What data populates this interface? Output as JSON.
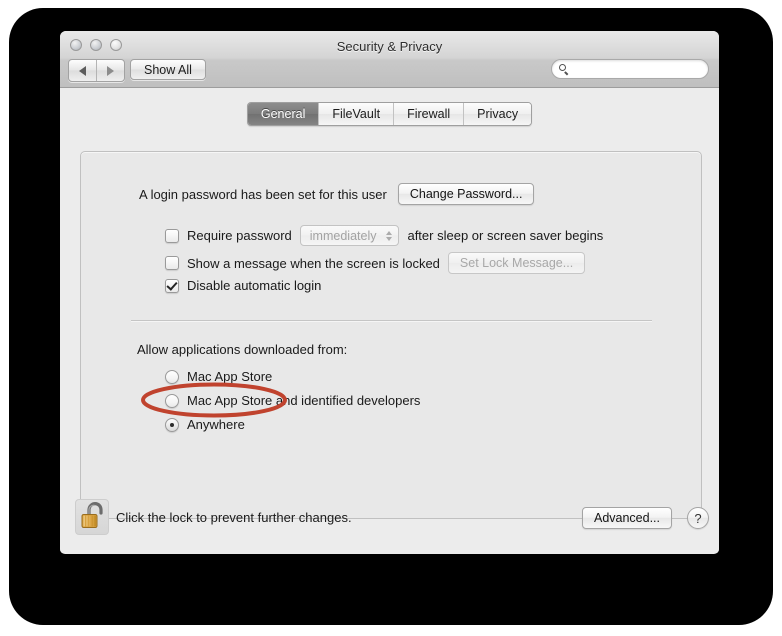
{
  "window": {
    "title": "Security & Privacy",
    "traffic_lights": [
      "close-button",
      "minimize-button",
      "zoom-button"
    ],
    "toolbar": {
      "back_label": "◀",
      "forward_label": "▶",
      "show_all_label": "Show All",
      "search_value": "",
      "search_placeholder": ""
    }
  },
  "tabs": [
    {
      "label": "General",
      "selected": true
    },
    {
      "label": "FileVault",
      "selected": false
    },
    {
      "label": "Firewall",
      "selected": false
    },
    {
      "label": "Privacy",
      "selected": false
    }
  ],
  "general": {
    "password_status": "A login password has been set for this user",
    "change_password_label": "Change Password...",
    "require_password": {
      "checked": false,
      "label_before": "Require password",
      "popup_value": "immediately",
      "popup_disabled": true,
      "label_after": "after sleep or screen saver begins"
    },
    "lock_message": {
      "checked": false,
      "label": "Show a message when the screen is locked",
      "button_label": "Set Lock Message...",
      "button_disabled": true
    },
    "disable_auto_login": {
      "checked": true,
      "label": "Disable automatic login"
    },
    "allow_apps": {
      "group_label": "Allow applications downloaded from:",
      "options": [
        {
          "label": "Mac App Store",
          "selected": false
        },
        {
          "label": "Mac App Store and identified developers",
          "selected": false
        },
        {
          "label": "Anywhere",
          "selected": true
        }
      ],
      "annotation": {
        "shape": "ellipse",
        "target": "Anywhere",
        "color": "#c0432e"
      }
    }
  },
  "footer": {
    "lock_icon": "open-padlock-icon",
    "lock_text": "Click the lock to prevent further changes.",
    "advanced_label": "Advanced...",
    "help_label": "?"
  }
}
